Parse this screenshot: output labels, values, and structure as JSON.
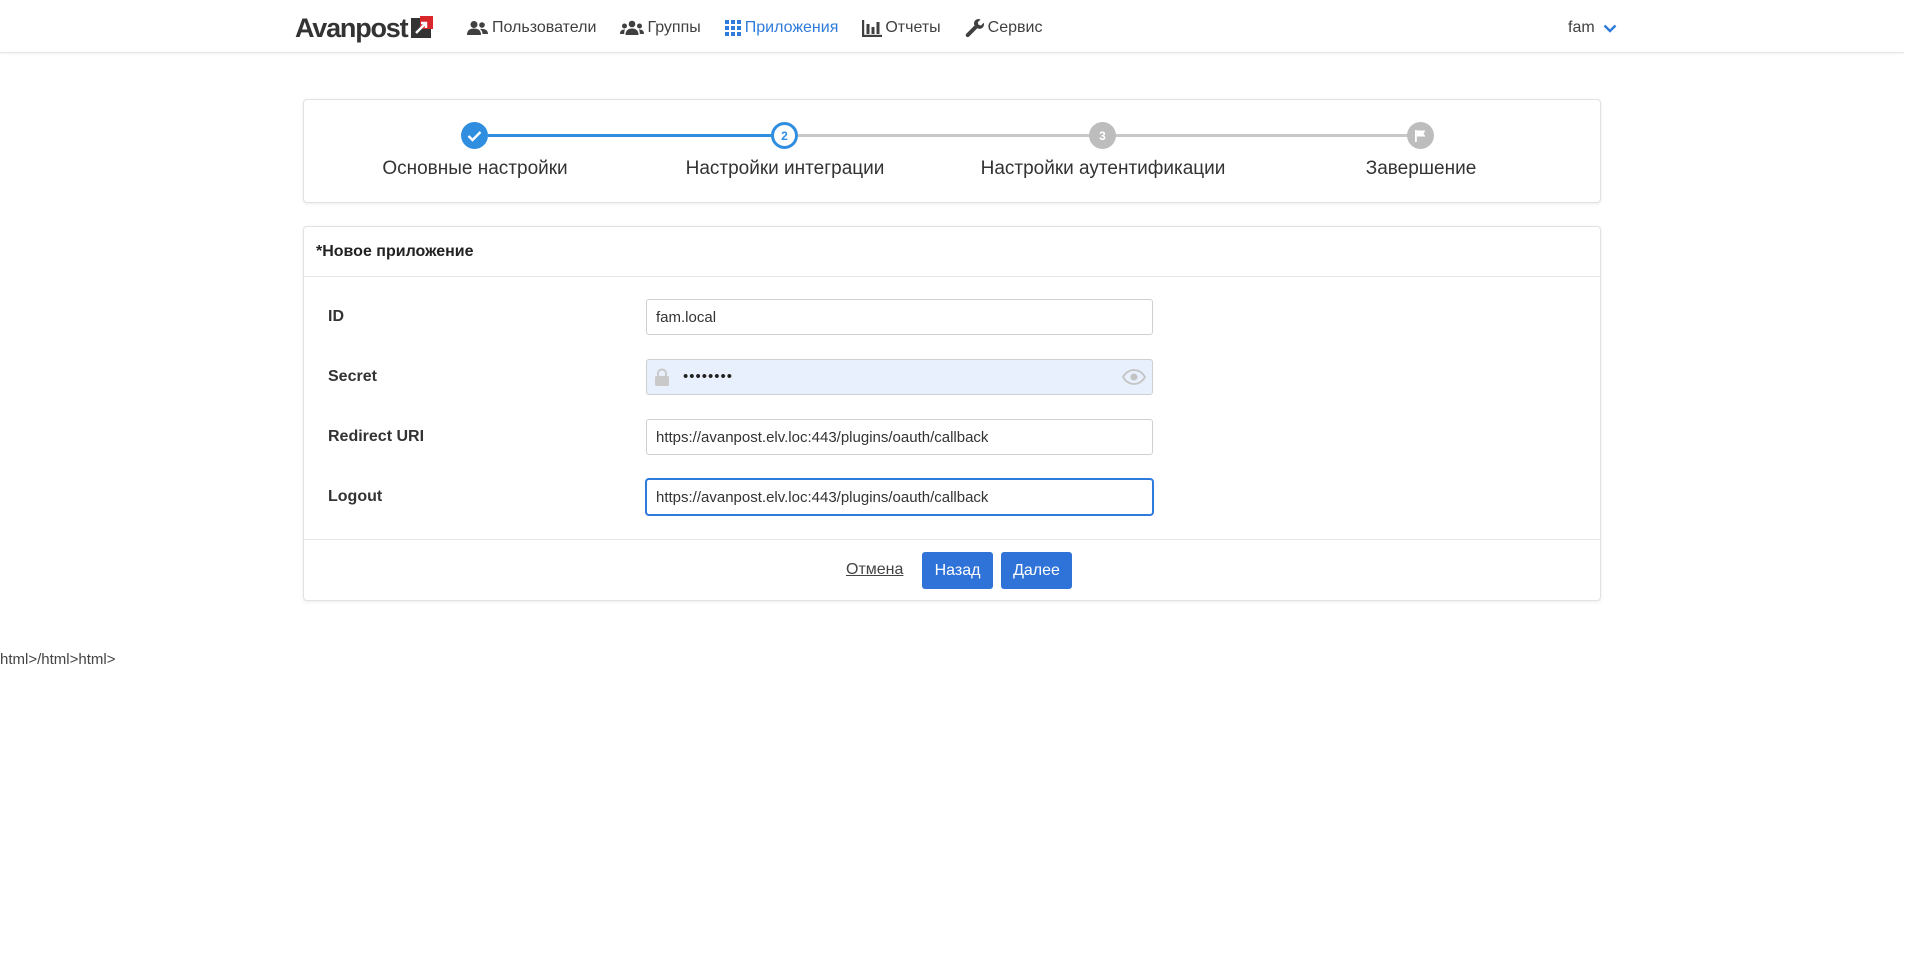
{
  "brand": {
    "name": "Avanpost",
    "accent": "#2f7bdc",
    "logo_red": "#d9262b"
  },
  "nav": {
    "items": [
      {
        "label": "Пользователи",
        "icon": "users-icon",
        "active": false
      },
      {
        "label": "Группы",
        "icon": "group-icon",
        "active": false
      },
      {
        "label": "Приложения",
        "icon": "apps-grid-icon",
        "active": true
      },
      {
        "label": "Отчеты",
        "icon": "bar-chart-icon",
        "active": false
      },
      {
        "label": "Сервис",
        "icon": "wrench-icon",
        "active": false
      }
    ],
    "user": "fam"
  },
  "stepper": {
    "steps": [
      {
        "label": "Основные настройки",
        "state": "done",
        "marker": "check"
      },
      {
        "label": "Настройки интеграции",
        "state": "current",
        "marker": "2"
      },
      {
        "label": "Настройки аутентификации",
        "state": "pending",
        "marker": "3"
      },
      {
        "label": "Завершение",
        "state": "pending",
        "marker": "flag"
      }
    ]
  },
  "form": {
    "title": "*Новое приложение",
    "fields": {
      "id": {
        "label": "ID",
        "value": "fam.local"
      },
      "secret": {
        "label": "Secret",
        "masked_value": "••••••••"
      },
      "redirect_uri": {
        "label": "Redirect URI",
        "value": "https://avanpost.elv.loc:443/plugins/oauth/callback"
      },
      "logout": {
        "label": "Logout",
        "value": "https://avanpost.elv.loc:443/plugins/oauth/callback"
      }
    },
    "actions": {
      "cancel": "Отмена",
      "back": "Назад",
      "next": "Далее"
    }
  },
  "stray_text": "html>/html>html>"
}
